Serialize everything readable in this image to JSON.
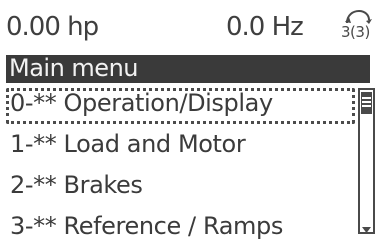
{
  "status": {
    "power": "0.00 hp",
    "frequency": "0.0 Hz",
    "setup": "3(3)"
  },
  "menu": {
    "title": "Main menu",
    "items": [
      {
        "label": "0-** Operation/Display",
        "selected": true
      },
      {
        "label": "1-** Load and Motor",
        "selected": false
      },
      {
        "label": "2-** Brakes",
        "selected": false
      },
      {
        "label": "3-** Reference / Ramps",
        "selected": false
      }
    ]
  },
  "scrollbar": {
    "position": 0
  },
  "icons": {
    "setup": "setup-cycle-icon",
    "scroll_down": "scroll-down-arrow-icon"
  }
}
